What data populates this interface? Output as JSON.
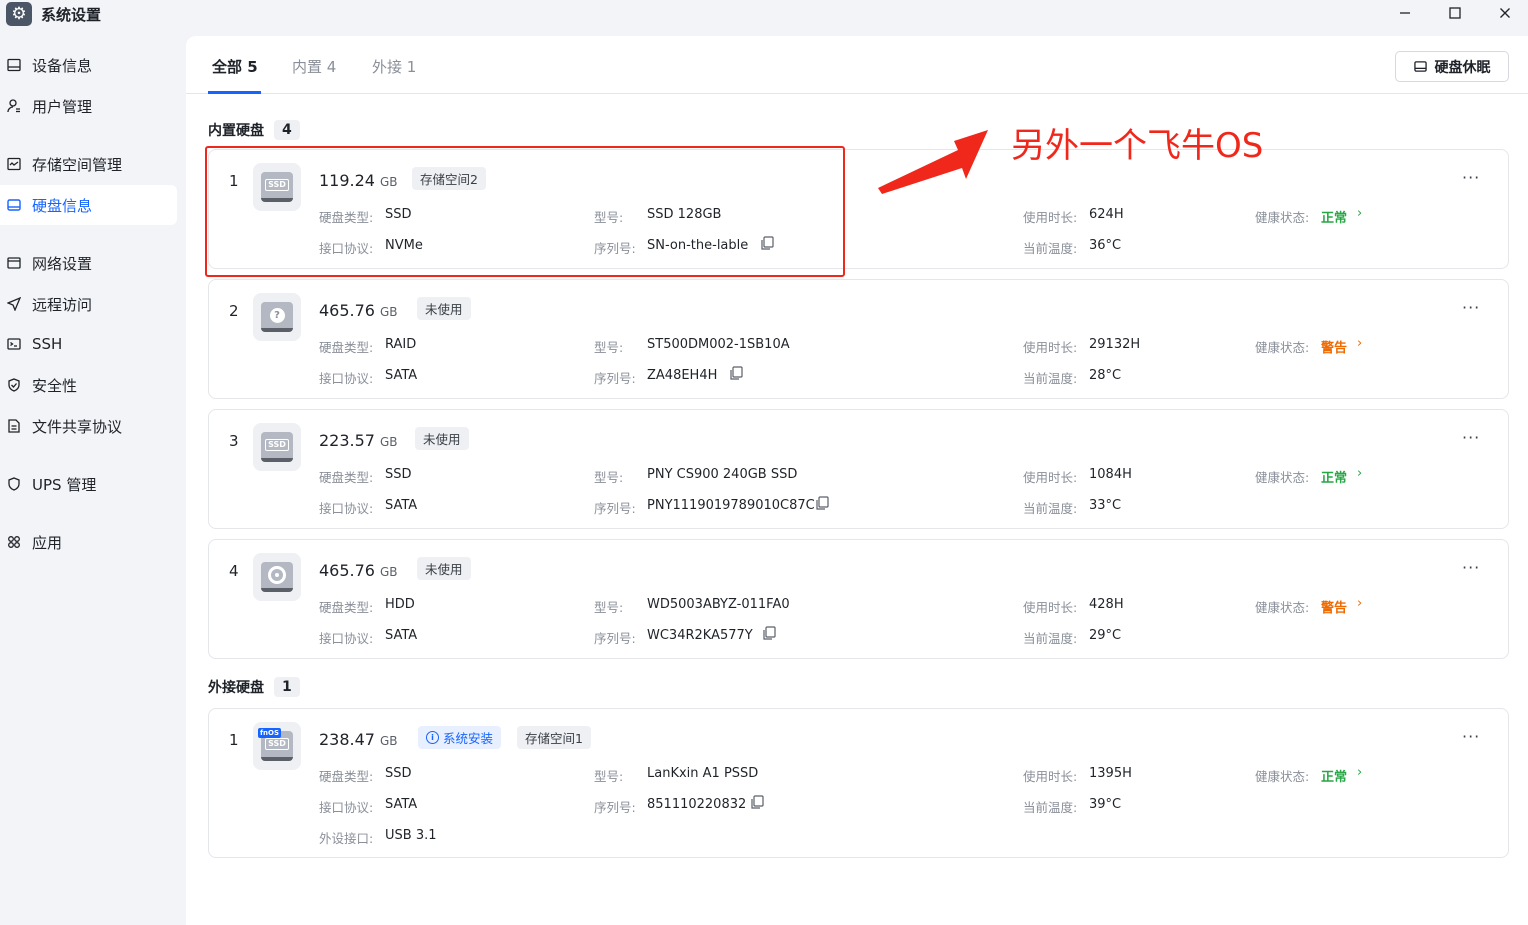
{
  "window": {
    "title": "系统设置",
    "icon": "gear-icon",
    "controls": [
      "minimize",
      "maximize",
      "close"
    ]
  },
  "sidebar": {
    "items": [
      {
        "label": "设备信息",
        "icon": "device-info-icon",
        "active": false
      },
      {
        "label": "用户管理",
        "icon": "user-icon",
        "active": false
      },
      {
        "label": "存储空间管理",
        "icon": "storage-icon",
        "active": false
      },
      {
        "label": "硬盘信息",
        "icon": "disk-icon",
        "active": true
      },
      {
        "label": "网络设置",
        "icon": "network-icon",
        "active": false
      },
      {
        "label": "远程访问",
        "icon": "send-icon",
        "active": false
      },
      {
        "label": "SSH",
        "icon": "terminal-icon",
        "active": false
      },
      {
        "label": "安全性",
        "icon": "shield-check-icon",
        "active": false
      },
      {
        "label": "文件共享协议",
        "icon": "file-icon",
        "active": false
      },
      {
        "label": "UPS 管理",
        "icon": "shield-icon",
        "active": false
      },
      {
        "label": "应用",
        "icon": "apps-icon",
        "active": false
      }
    ]
  },
  "tabs": [
    {
      "label": "全部 5",
      "active": true
    },
    {
      "label": "内置 4",
      "active": false
    },
    {
      "label": "外接 1",
      "active": false
    }
  ],
  "toolbar": {
    "sleep_label": "硬盘休眠"
  },
  "labels": {
    "disk_type": "硬盘类型:",
    "protocol": "接口协议:",
    "model": "型号:",
    "serial": "序列号:",
    "usage": "使用时长:",
    "temp": "当前温度:",
    "health": "健康状态:",
    "external_port": "外设接口:"
  },
  "internal": {
    "title": "内置硬盘",
    "count": "4",
    "disks": [
      {
        "index": "1",
        "capacity": "119.24",
        "unit": "GB",
        "tags": [
          "存储空间2"
        ],
        "icon": "ssd-icon",
        "type": "SSD",
        "protocol": "NVMe",
        "model": "SSD 128GB",
        "serial": "SN-on-the-lable",
        "usage": "624H",
        "temp": "36°C",
        "health": "正常",
        "health_level": "ok"
      },
      {
        "index": "2",
        "capacity": "465.76",
        "unit": "GB",
        "tags": [
          "未使用"
        ],
        "icon": "unknown-disk-icon",
        "type": "RAID",
        "protocol": "SATA",
        "model": "ST500DM002-1SB10A",
        "serial": "ZA48EH4H",
        "usage": "29132H",
        "temp": "28°C",
        "health": "警告",
        "health_level": "warn"
      },
      {
        "index": "3",
        "capacity": "223.57",
        "unit": "GB",
        "tags": [
          "未使用"
        ],
        "icon": "ssd-icon",
        "type": "SSD",
        "protocol": "SATA",
        "model": "PNY CS900 240GB SSD",
        "serial": "PNY1119019789010C87C",
        "usage": "1084H",
        "temp": "33°C",
        "health": "正常",
        "health_level": "ok"
      },
      {
        "index": "4",
        "capacity": "465.76",
        "unit": "GB",
        "tags": [
          "未使用"
        ],
        "icon": "hdd-icon",
        "type": "HDD",
        "protocol": "SATA",
        "model": "WD5003ABYZ-011FA0",
        "serial": "WC34R2KA577Y",
        "usage": "428H",
        "temp": "29°C",
        "health": "警告",
        "health_level": "warn"
      }
    ]
  },
  "external": {
    "title": "外接硬盘",
    "count": "1",
    "disks": [
      {
        "index": "1",
        "capacity": "238.47",
        "unit": "GB",
        "tags": [
          "系统安装",
          "存储空间1"
        ],
        "icon": "fnos-ssd-icon",
        "badge": "fnOS",
        "icon_label": "SSD",
        "type": "SSD",
        "protocol": "SATA",
        "model": "LanKxin A1 PSSD",
        "serial": "851110220832",
        "usage": "1395H",
        "temp": "39°C",
        "health": "正常",
        "health_level": "ok",
        "port": "USB 3.1"
      }
    ]
  },
  "annotation": {
    "text": "另外一个飞牛OS",
    "color": "#f0281c"
  },
  "colors": {
    "accent": "#1664ff",
    "ok": "#28a745",
    "warn": "#f06a00"
  }
}
